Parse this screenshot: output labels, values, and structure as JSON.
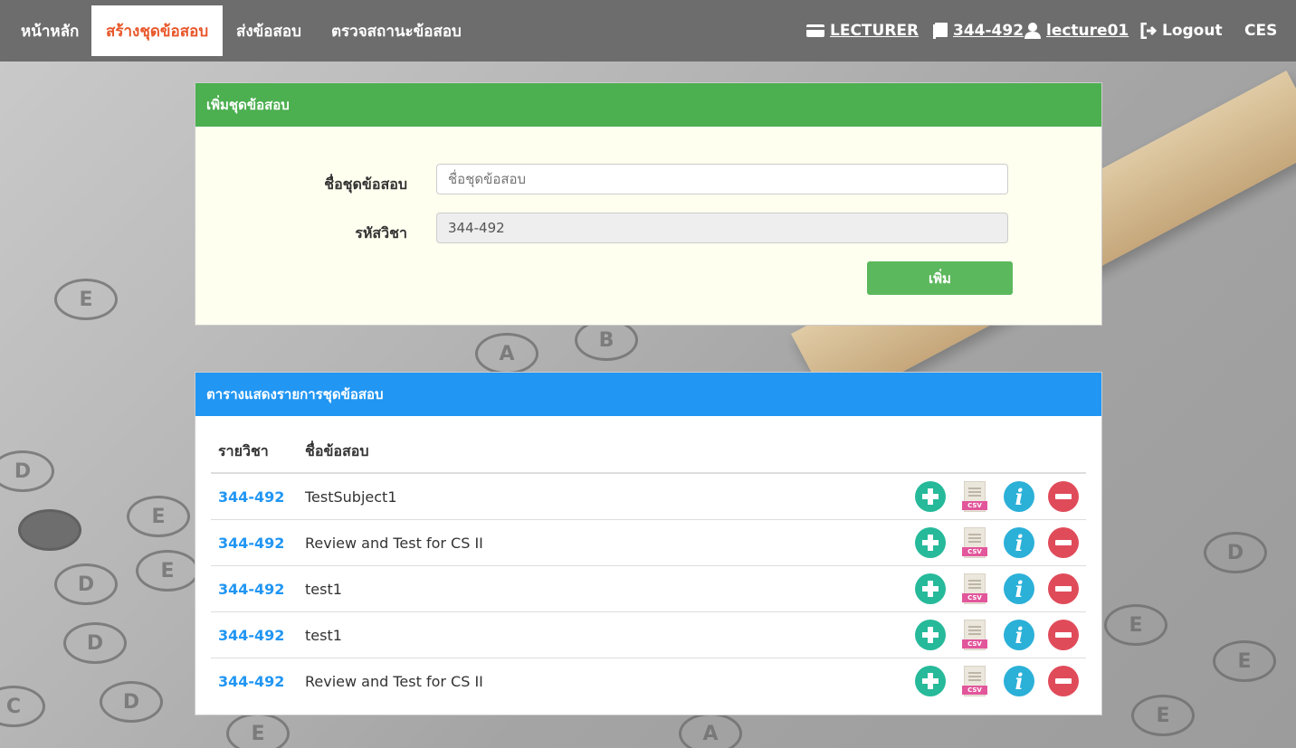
{
  "nav": {
    "home": "หน้าหลัก",
    "create": "สร้างชุดข้อสอบ",
    "submit": "ส่งข้อสอบ",
    "check": "ตรวจสถานะข้อสอบ",
    "role": "LECTURER",
    "course": "344-492",
    "user": "lecture01",
    "logout": "Logout",
    "brand": "CES"
  },
  "add_panel": {
    "title": "เพิ่มชุดข้อสอบ",
    "name_label": "ชื่อชุดข้อสอบ",
    "name_placeholder": "ชื่อชุดข้อสอบ",
    "code_label": "รหัสวิชา",
    "code_value": "344-492",
    "submit_label": "เพิ่ม"
  },
  "list_panel": {
    "title": "ตารางแสดงรายการชุดข้อสอบ",
    "headers": [
      "รายวิชา",
      "ชื่อข้อสอบ"
    ],
    "csv_tag": "CSV",
    "info_glyph": "i",
    "rows": [
      {
        "code": "344-492",
        "name": "TestSubject1"
      },
      {
        "code": "344-492",
        "name": "Review and Test for CS II"
      },
      {
        "code": "344-492",
        "name": "test1"
      },
      {
        "code": "344-492",
        "name": "test1"
      },
      {
        "code": "344-492",
        "name": "Review and Test for CS II"
      }
    ]
  },
  "background": {
    "bubble_letters": [
      "E",
      "D",
      "E",
      "D",
      "E",
      "D",
      "C",
      "D",
      "E",
      "A",
      "B",
      "A",
      "E",
      "E",
      "D",
      "E"
    ]
  },
  "colors": {
    "navbar": "#6d6d6d",
    "active_tab_text": "#e8572a",
    "add_header": "#4caf50",
    "list_header": "#2196f3",
    "plus": "#26b99a",
    "info": "#2bb0d8",
    "minus": "#e04b5a",
    "csv": "#e2569b"
  }
}
